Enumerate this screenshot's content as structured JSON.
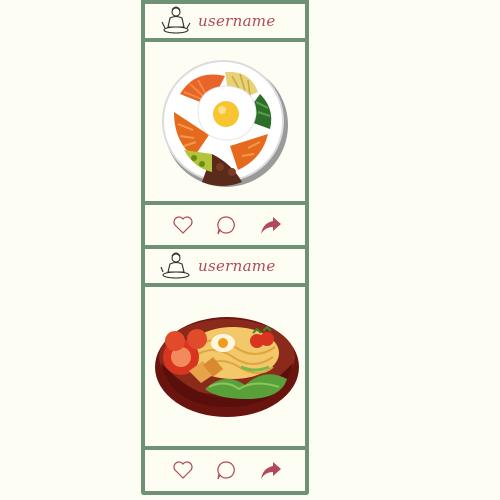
{
  "posts": [
    {
      "username": "username",
      "image": "bibimbap-bowl",
      "actions": [
        "heart-icon",
        "comment-icon",
        "share-icon"
      ]
    },
    {
      "username": "username",
      "image": "ramen-bowl",
      "actions": [
        "heart-icon",
        "comment-icon",
        "share-icon"
      ]
    }
  ],
  "colors": {
    "frame": "#6f9175",
    "username": "#b2485c",
    "background": "#fdfdf3",
    "share": "#b2485c"
  }
}
